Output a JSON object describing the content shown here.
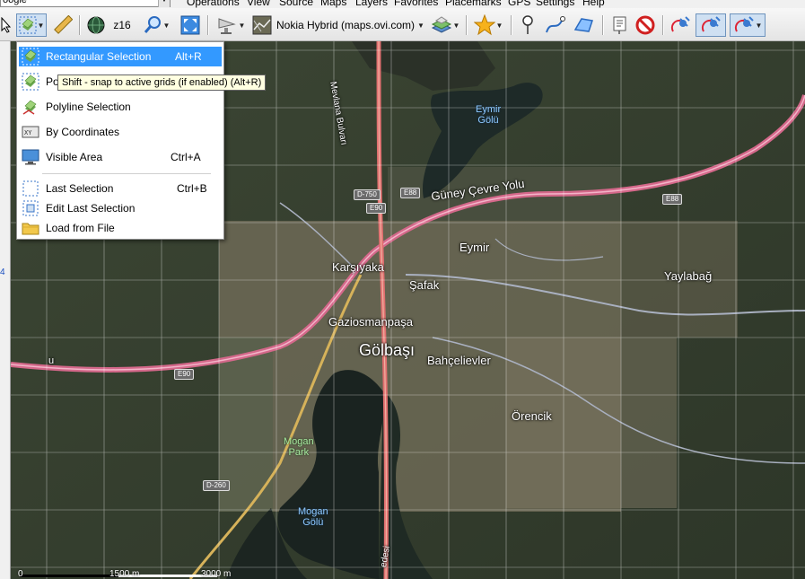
{
  "menubar": {
    "search_combo": "oogle",
    "items": [
      "Operations",
      "View",
      "Source",
      "Maps",
      "Layers",
      "Favorites",
      "Placemarks",
      "GPS",
      "Settings",
      "Help"
    ]
  },
  "toolbar": {
    "zoom_label": "z16",
    "map_source": "Nokia Hybrid (maps.ovi.com)"
  },
  "selection_menu": {
    "items": [
      {
        "label": "Rectangular Selection",
        "shortcut": "Alt+R",
        "icon": "rectangular-selection-icon",
        "highlighted": true
      },
      {
        "label": "Po",
        "shortcut": "",
        "icon": "polygon-selection-icon"
      },
      {
        "label": "Polyline Selection",
        "shortcut": "",
        "icon": "polyline-selection-icon"
      },
      {
        "label": "By Coordinates",
        "shortcut": "",
        "icon": "coordinates-icon"
      },
      {
        "label": "Visible Area",
        "shortcut": "Ctrl+A",
        "icon": "monitor-icon"
      },
      {
        "label": "Last Selection",
        "shortcut": "Ctrl+B",
        "icon": "dashed-rect-icon"
      },
      {
        "label": "Edit Last Selection",
        "shortcut": "",
        "icon": "edit-rect-icon"
      },
      {
        "label": "Load from File",
        "shortcut": "",
        "icon": "folder-icon"
      }
    ]
  },
  "tooltip": "Shift - snap to active grids (if enabled) (Alt+R)",
  "left_strip_number": "4",
  "map": {
    "labels": {
      "mevlana": "Mevlana Bulvarı",
      "eymir_golu": "Eymir\nGölü",
      "guney_cevre": "Güney Çevre Yolu",
      "eymir": "Eymir",
      "karsiyaka": "Karşıyaka",
      "safak": "Şafak",
      "yaylabag": "Yaylabağ",
      "gaziosmanpasa": "Gaziosmanpaşa",
      "golbasi": "Gölbaşı",
      "bahcelievler": "Bahçelievler",
      "orencik": "Örencik",
      "mogan_park": "Mogan\nPark",
      "mogan_golu": "Mogan\nGölü",
      "u_edge": "u",
      "edesi": "edesi"
    },
    "shields": {
      "d750": "D-750",
      "e88a": "E88",
      "e90a": "E90",
      "e88b": "E88",
      "e90b": "E90",
      "d260": "D-260"
    },
    "scale": {
      "zero": "0",
      "mid": "1500 m",
      "end": "3000 m"
    }
  },
  "colors": {
    "menu_highlight": "#3399ff",
    "road_pink": "#d4688a",
    "grid_line": "#ffffff"
  }
}
